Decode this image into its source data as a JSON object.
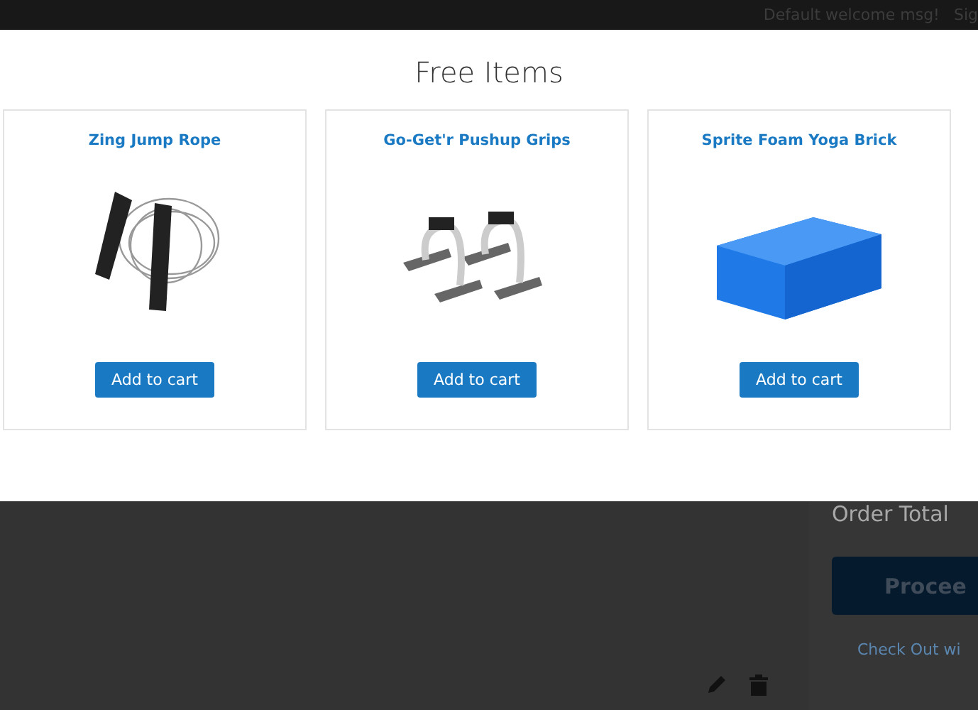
{
  "header": {
    "welcome": "Default welcome msg!",
    "sign_in": "Sig"
  },
  "modal": {
    "title": "Free Items",
    "products": [
      {
        "name": "Zing Jump Rope",
        "kind": "jump-rope",
        "button": "Add to cart"
      },
      {
        "name": "Go-Get'r Pushup Grips",
        "kind": "pushup-grips",
        "button": "Add to cart"
      },
      {
        "name": "Sprite Foam Yoga Brick",
        "kind": "foam-block",
        "button": "Add to cart"
      }
    ]
  },
  "summary": {
    "order_total": "Order Total",
    "proceed": "Procee",
    "checkout_link": "Check Out wi"
  }
}
